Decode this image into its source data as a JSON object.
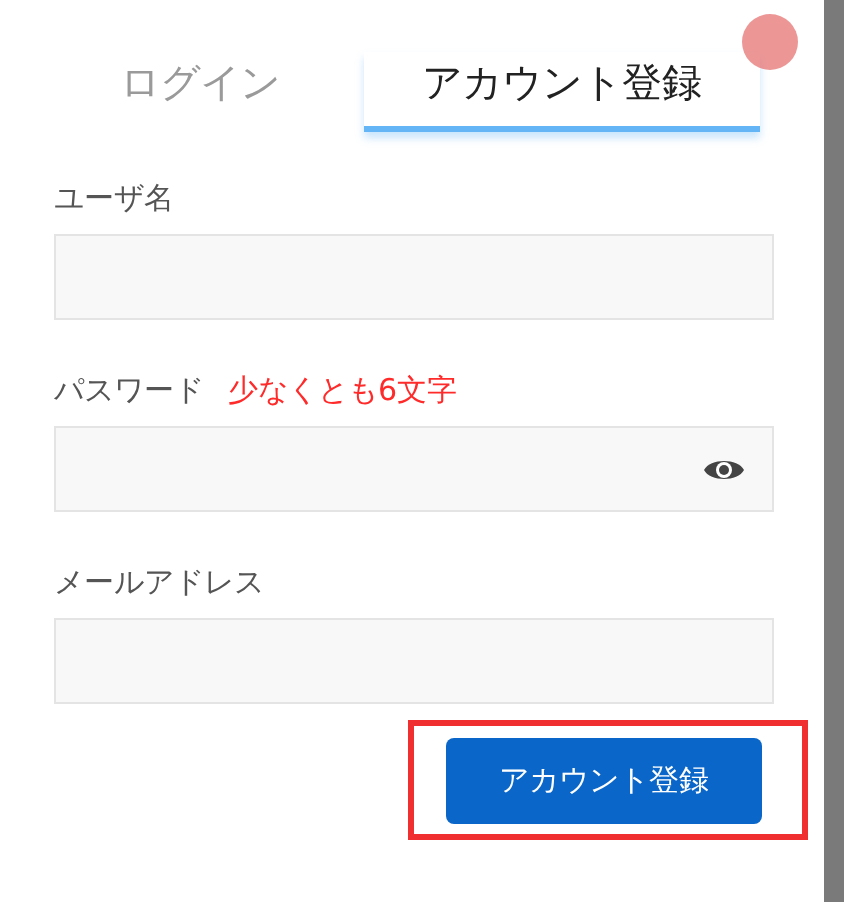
{
  "tabs": [
    {
      "label": "ログイン",
      "selected": false
    },
    {
      "label": "アカウント登録",
      "selected": true
    }
  ],
  "fields": [
    {
      "kind": "text",
      "label": "ユーザ名"
    },
    {
      "kind": "password",
      "label": "パスワード",
      "hint": "少なくとも6文字"
    },
    {
      "kind": "text",
      "label": "メールアドレス"
    }
  ],
  "submit": {
    "label": "アカウント登録",
    "highlighted": true
  }
}
